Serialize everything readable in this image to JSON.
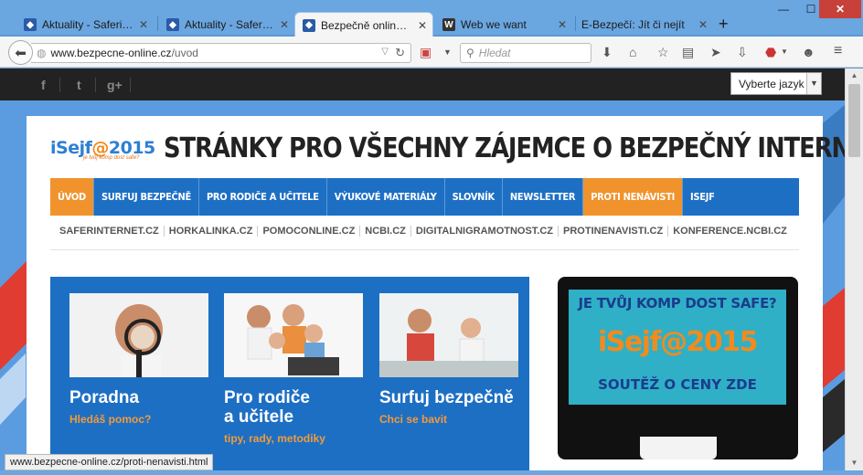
{
  "browser": {
    "tabs": [
      {
        "title": "Aktuality - Saferinte...",
        "icon": "shield-favicon",
        "active": false
      },
      {
        "title": "Aktuality - Saferinte...",
        "icon": "shield-favicon",
        "active": false
      },
      {
        "title": "Bezpečně online | B...",
        "icon": "shield-favicon",
        "active": true
      },
      {
        "title": "Web we want",
        "icon": "w-favicon",
        "active": false
      },
      {
        "title": "E-Bezpečí: Jít či nejít",
        "icon": "",
        "active": false
      }
    ],
    "new_tab": "+",
    "window_buttons": {
      "minimize": "—",
      "maximize": "☐",
      "close": "✕"
    },
    "url_host": "www.bezpecne-online.cz",
    "url_path": "/uvod",
    "search_placeholder": "Hledat",
    "status_url": "www.bezpecne-online.cz/proti-nenavisti.html"
  },
  "site": {
    "social": [
      "f",
      "t",
      "g+"
    ],
    "language_select": "Vyberte jazyk",
    "logo_text": "iSejf",
    "logo_at": "@",
    "logo_year": "2015",
    "logo_tagline": "je tvůj komp dost safe?",
    "headline": "STRÁNKY PRO VŠECHNY ZÁJEMCE O BEZPEČNÝ INTERNET",
    "main_nav": [
      {
        "label": "ÚVOD",
        "highlight": true
      },
      {
        "label": "SURFUJ BEZPEČNĚ",
        "highlight": false
      },
      {
        "label": "PRO RODIČE A UČITELE",
        "highlight": false
      },
      {
        "label": "VÝUKOVÉ MATERIÁLY",
        "highlight": false
      },
      {
        "label": "SLOVNÍK",
        "highlight": false
      },
      {
        "label": "NEWSLETTER",
        "highlight": false
      },
      {
        "label": "PROTI NENÁVISTI",
        "highlight": true
      },
      {
        "label": "ISEJF",
        "highlight": false
      }
    ],
    "sub_nav": [
      "SAFERINTERNET.CZ",
      "HORKALINKA.CZ",
      "POMOCONLINE.CZ",
      "NCBI.CZ",
      "DIGITALNIGRAMOTNOST.CZ",
      "PROTINENAVISTI.CZ",
      "KONFERENCE.NCBI.CZ"
    ],
    "features": [
      {
        "title": "Poradna",
        "subtitle": "Hledáš pomoc?"
      },
      {
        "title_line1": "Pro rodiče",
        "title_line2": "a učitele",
        "subtitle": "tipy, rady, metodiky"
      },
      {
        "title": "Surfuj bezpečně",
        "subtitle": "Chci se bavit"
      }
    ],
    "promo": {
      "question": "JE TVŮJ KOMP DOST SAFE?",
      "brand": "iSejf",
      "at": "@",
      "year": "2015",
      "prize": "SOUTĚŽ O CENY ZDE"
    }
  },
  "colors": {
    "accent_blue": "#1d6fc4",
    "accent_orange": "#f0932c",
    "titlebar": "#6aa6e0"
  }
}
